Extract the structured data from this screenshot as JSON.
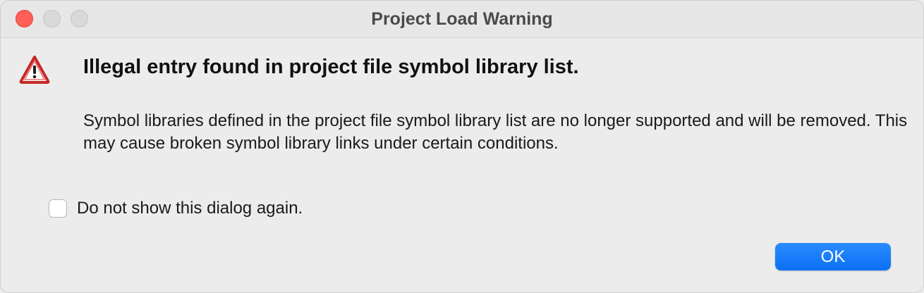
{
  "window": {
    "title": "Project Load Warning"
  },
  "dialog": {
    "heading": "Illegal entry found in project file symbol library list.",
    "message": "Symbol libraries defined in the project file symbol library list are no longer supported and will be removed.  This may cause broken symbol library links under certain conditions.",
    "checkbox_label": "Do not show this dialog again.",
    "checkbox_checked": false,
    "ok_label": "OK",
    "icon": "warning-triangle-icon"
  },
  "colors": {
    "close_button": "#fe5f57",
    "accent": "#0a70f5",
    "warning": "#d32f2f"
  }
}
